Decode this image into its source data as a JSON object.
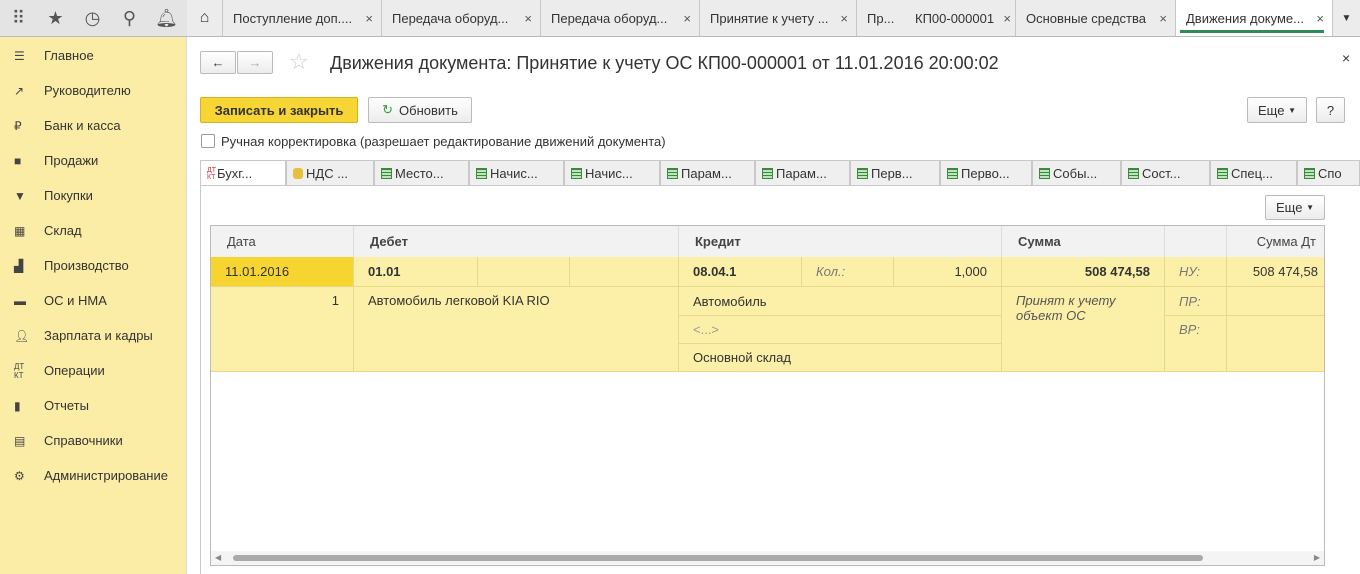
{
  "toolbar": {
    "icons": [
      "apps-icon",
      "star-icon",
      "history-icon",
      "search-icon",
      "bell-icon"
    ]
  },
  "open_tabs": [
    "Поступление доп....",
    "Передача оборуд...",
    "Передача оборуд...",
    "Принятие к учету ...",
    "Пр...",
    "КП00-000001",
    "Основные средства",
    "Движения докуме..."
  ],
  "sidebar": {
    "items": [
      "Главное",
      "Руководителю",
      "Банк и касса",
      "Продажи",
      "Покупки",
      "Склад",
      "Производство",
      "ОС и НМА",
      "Зарплата и кадры",
      "Операции",
      "Отчеты",
      "Справочники",
      "Администрирование"
    ]
  },
  "doc": {
    "title": "Движения документа: Принятие к учету ОС КП00-000001 от 11.01.2016 20:00:02",
    "save_close": "Записать и закрыть",
    "refresh": "Обновить",
    "more": "Еще",
    "help": "?",
    "manual_label": "Ручная корректировка (разрешает редактирование движений документа)",
    "tabs": [
      "Бухг...",
      "НДС ...",
      "Место...",
      "Начис...",
      "Начис...",
      "Парам...",
      "Парам...",
      "Перв...",
      "Перво...",
      "Собы...",
      "Сост...",
      "Спец...",
      "Спо"
    ]
  },
  "table": {
    "headers": [
      "Дата",
      "Дебет",
      "Кредит",
      "Сумма",
      "",
      "Сумма Дт"
    ],
    "row": {
      "date": "11.01.2016",
      "num": "1",
      "debit": "01.01",
      "debit_sub": "Автомобиль легковой KIA RIO",
      "credit": "08.04.1",
      "qty_label": "Кол.:",
      "qty": "1,000",
      "credit_sub1": "Автомобиль",
      "credit_sub2": "<...>",
      "credit_sub3": "Основной склад",
      "sum": "508 474,58",
      "content": "Принят к учету объект ОС",
      "nu": "НУ:",
      "pr": "ПР:",
      "vr": "ВР:",
      "sum_dt": "508 474,58"
    }
  }
}
